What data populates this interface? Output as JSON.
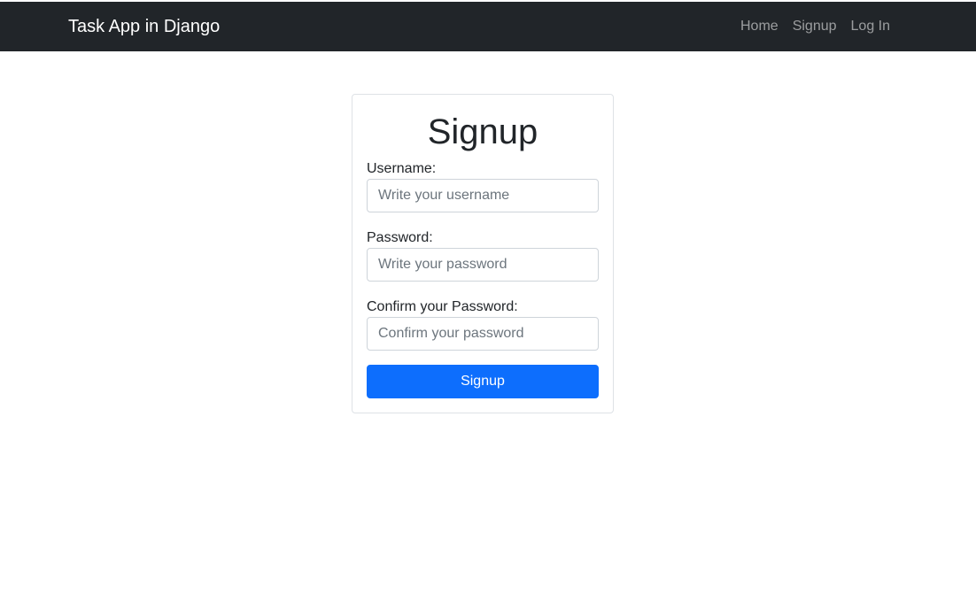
{
  "navbar": {
    "brand": "Task App in Django",
    "links": [
      {
        "label": "Home"
      },
      {
        "label": "Signup"
      },
      {
        "label": "Log In"
      }
    ]
  },
  "form": {
    "title": "Signup",
    "fields": [
      {
        "label": "Username:",
        "placeholder": "Write your username",
        "value": ""
      },
      {
        "label": "Password:",
        "placeholder": "Write your password",
        "value": ""
      },
      {
        "label": "Confirm your Password:",
        "placeholder": "Confirm your password",
        "value": ""
      }
    ],
    "submit_label": "Signup"
  },
  "colors": {
    "navbar_bg": "#212529",
    "primary": "#0d6efd",
    "nav_link": "rgba(255,255,255,0.55)"
  }
}
